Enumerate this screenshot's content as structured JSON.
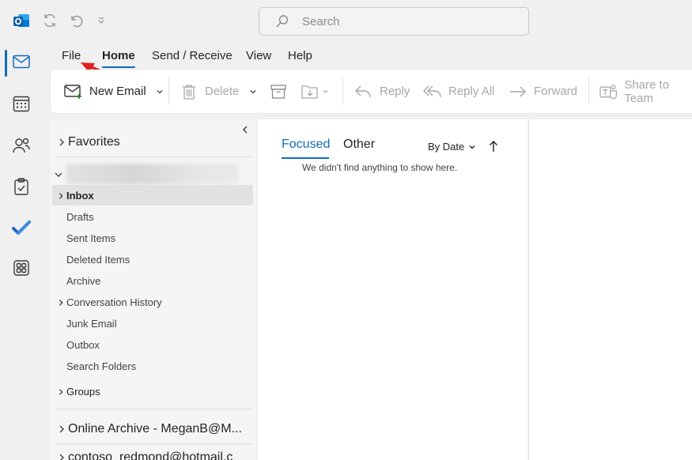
{
  "titlebar": {
    "search_placeholder": "Search"
  },
  "menu": {
    "items": [
      {
        "label": "File"
      },
      {
        "label": "Home"
      },
      {
        "label": "Send / Receive"
      },
      {
        "label": "View"
      },
      {
        "label": "Help"
      }
    ]
  },
  "ribbon": {
    "new_email": "New Email",
    "delete": "Delete",
    "reply": "Reply",
    "reply_all": "Reply All",
    "forward": "Forward",
    "share_to_teams": "Share to Team"
  },
  "folders": {
    "favorites": "Favorites",
    "items": [
      {
        "label": "Inbox"
      },
      {
        "label": "Drafts"
      },
      {
        "label": "Sent Items"
      },
      {
        "label": "Deleted Items"
      },
      {
        "label": "Archive"
      },
      {
        "label": "Conversation History"
      },
      {
        "label": "Junk Email"
      },
      {
        "label": "Outbox"
      },
      {
        "label": "Search Folders"
      }
    ],
    "groups": "Groups",
    "online_archive": "Online Archive - MeganB@M...",
    "other_account": "contoso_redmond@hotmail.c"
  },
  "message_list": {
    "tab_focused": "Focused",
    "tab_other": "Other",
    "sort_label": "By Date",
    "empty_text": "We didn't find anything to show here."
  },
  "colors": {
    "accent": "#0f6cbd",
    "annotation_arrow": "#e02020"
  }
}
